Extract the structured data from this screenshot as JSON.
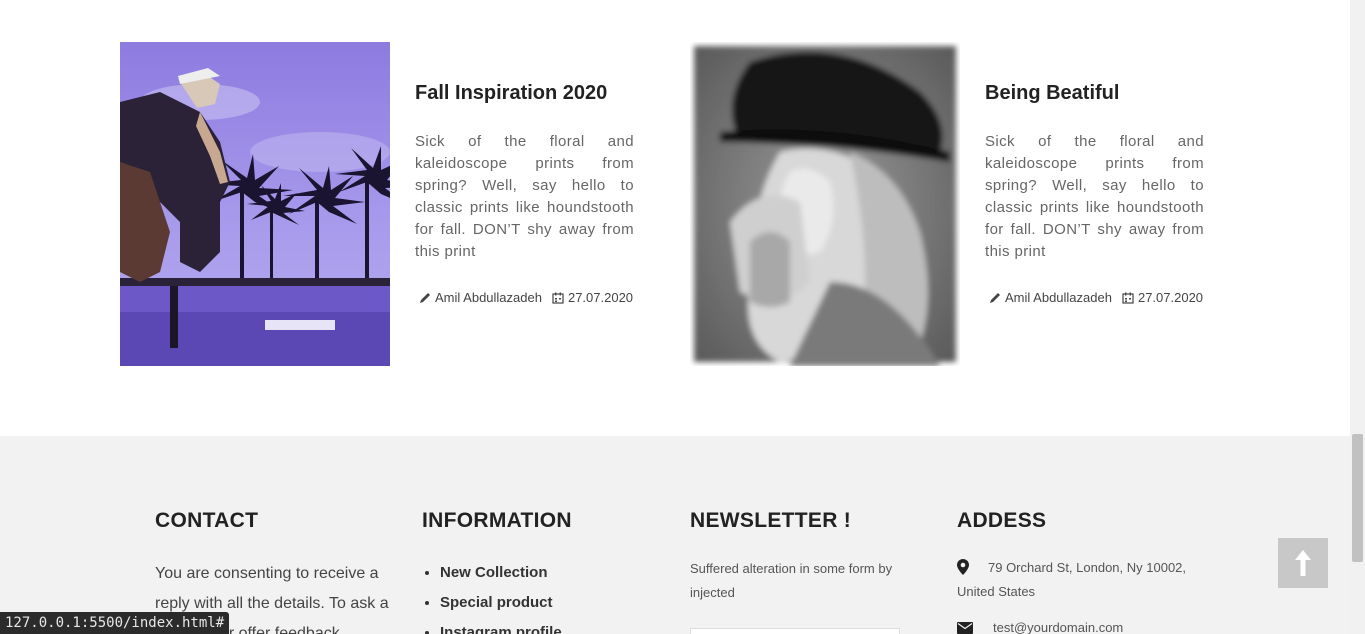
{
  "posts": [
    {
      "title": "Fall Inspiration 2020",
      "excerpt": "Sick of the floral and kaleidoscope prints from spring? Well, say hello to classic prints like houndstooth for fall. DON’T shy away from this print",
      "author": "Amil Abdullazadeh",
      "date": "27.07.2020"
    },
    {
      "title": "Being Beatiful",
      "excerpt": "Sick of the floral and kaleidoscope prints from spring? Well, say hello to classic prints like houndstooth for fall. DON’T shy away from this print",
      "author": "Amil Abdullazadeh",
      "date": "27.07.2020"
    }
  ],
  "footer": {
    "contact": {
      "heading": "CONTACT",
      "text": "You are consenting to receive a reply with all the details. To ask a question or offer feedback"
    },
    "information": {
      "heading": "INFORMATION",
      "links": [
        "New Collection",
        "Special product",
        "Instagram profile"
      ]
    },
    "newsletter": {
      "heading": "NEWSLETTER !",
      "text": "Suffered alteration in some form by injected"
    },
    "address": {
      "heading": "ADDESS",
      "street": "79 Orchard St, London, Ny 10002, United States",
      "email": "test@yourdomain.com"
    }
  },
  "status_url": "127.0.0.1:5500/index.html#",
  "icons": {
    "author": "pencil-icon",
    "date": "calendar-icon",
    "location": "map-marker-icon",
    "email": "envelope-icon",
    "back_to_top": "arrow-up-icon"
  },
  "colors": {
    "footer_bg": "#f2f2f2",
    "back_to_top_bg": "#c8c8c8",
    "status_bar_bg": "#2b2b2b"
  }
}
